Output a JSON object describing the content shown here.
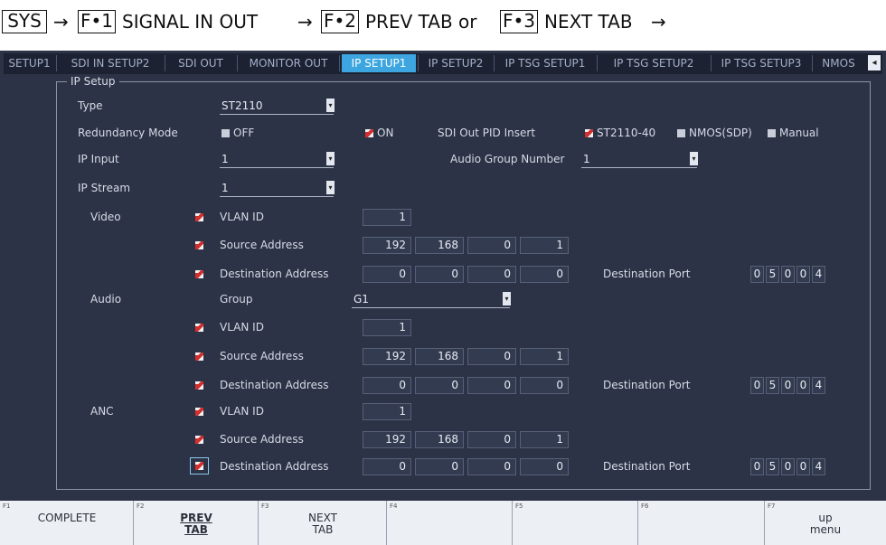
{
  "breadcrumb": {
    "sys": "SYS",
    "arrow": "→",
    "f1_key": "F•1",
    "f1_text": "SIGNAL IN OUT",
    "f2_key": "F•2",
    "f2_text": "PREV TAB or",
    "f3_key": "F•3",
    "f3_text": "NEXT TAB"
  },
  "tabs": [
    {
      "label": "SETUP1"
    },
    {
      "label": "SDI IN SETUP2"
    },
    {
      "label": "SDI OUT"
    },
    {
      "label": "MONITOR OUT"
    },
    {
      "label": "IP SETUP1"
    },
    {
      "label": "IP SETUP2"
    },
    {
      "label": "IP TSG SETUP1"
    },
    {
      "label": "IP TSG SETUP2"
    },
    {
      "label": "IP TSG SETUP3"
    },
    {
      "label": "NMOS"
    }
  ],
  "active_tab": "IP SETUP1",
  "scroll_arrow": "◂",
  "ip_setup": {
    "group_title": "IP Setup",
    "type_label": "Type",
    "type_value": "ST2110",
    "redundancy_label": "Redundancy Mode",
    "redundancy_off": "OFF",
    "redundancy_on": "ON",
    "redundancy_selected": "ON",
    "sdi_pid_label": "SDI Out PID Insert",
    "sdi_pid_options": [
      "ST2110-40",
      "NMOS(SDP)",
      "Manual"
    ],
    "sdi_pid_selected": "ST2110-40",
    "ip_input_label": "IP Input",
    "ip_input_value": "1",
    "audio_group_number_label": "Audio Group Number",
    "audio_group_number_value": "1",
    "ip_stream_label": "IP Stream",
    "ip_stream_value": "1",
    "dropdown_arrow": "▾",
    "video": {
      "label": "Video",
      "vlan_label": "VLAN ID",
      "vlan_value": "1",
      "src_label": "Source Address",
      "src": [
        "192",
        "168",
        "0",
        "1"
      ],
      "dst_label": "Destination Address",
      "dst": [
        "0",
        "0",
        "0",
        "0"
      ],
      "port_label": "Destination Port",
      "port": [
        "0",
        "5",
        "0",
        "0",
        "4"
      ]
    },
    "audio": {
      "label": "Audio",
      "group_label": "Group",
      "group_value": "G1",
      "vlan_label": "VLAN ID",
      "vlan_value": "1",
      "src_label": "Source Address",
      "src": [
        "192",
        "168",
        "0",
        "1"
      ],
      "dst_label": "Destination Address",
      "dst": [
        "0",
        "0",
        "0",
        "0"
      ],
      "port_label": "Destination Port",
      "port": [
        "0",
        "5",
        "0",
        "0",
        "4"
      ]
    },
    "anc": {
      "label": "ANC",
      "vlan_label": "VLAN ID",
      "vlan_value": "1",
      "src_label": "Source Address",
      "src": [
        "192",
        "168",
        "0",
        "1"
      ],
      "dst_label": "Destination Address",
      "dst": [
        "0",
        "0",
        "0",
        "0"
      ],
      "port_label": "Destination Port",
      "port": [
        "0",
        "5",
        "0",
        "0",
        "4"
      ]
    }
  },
  "function_keys": [
    {
      "num": "F1",
      "line1": "COMPLETE",
      "line2": ""
    },
    {
      "num": "F2",
      "line1": "PREV",
      "line2": "TAB"
    },
    {
      "num": "F3",
      "line1": "NEXT",
      "line2": "TAB"
    },
    {
      "num": "F4",
      "line1": "",
      "line2": ""
    },
    {
      "num": "F5",
      "line1": "",
      "line2": ""
    },
    {
      "num": "F6",
      "line1": "",
      "line2": ""
    },
    {
      "num": "F7",
      "line1": "up",
      "line2": "menu"
    }
  ],
  "colors": {
    "screen_bg": "#2c3346",
    "active_tab": "#3da6e0",
    "checkbox_checked": "#d32f2f",
    "fkey_bar": "#eceff4"
  }
}
